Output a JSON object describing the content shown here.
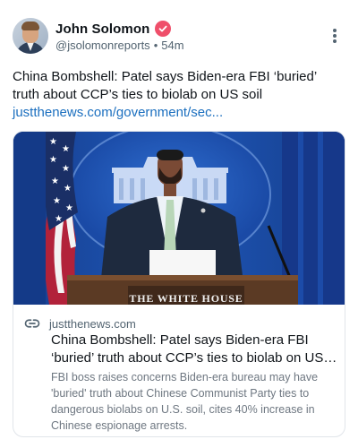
{
  "post": {
    "author": {
      "name": "John Solomon",
      "handle": "@jsolomonreports",
      "separator": "•",
      "timestamp": "54m",
      "verified_color": "#ef4f6a"
    },
    "text_line1": "China Bombshell: Patel says Biden-era FBI ‘buried’ truth about CCP’s ties to biolab on US soil",
    "link_text": "justthenews.com/government/sec...",
    "more_icon": "vertical-ellipsis-icon"
  },
  "card": {
    "image": {
      "sign_text": "THE WHITE HOUSE",
      "description_icons": [
        "american-flag",
        "speaker-at-podium"
      ]
    },
    "domain": "justthenews.com",
    "link_icon": "link-icon",
    "title_line1": "China Bombshell: Patel says Biden-era FBI",
    "title_line2": "‘buried’ truth about CCP’s ties to biolab on US s...",
    "description": "FBI boss raises concerns Biden-era bureau may have 'buried' truth about Chinese Communist Party ties to dangerous biolabs on U.S. soil, cites 40% increase in Chinese espionage arrests."
  },
  "colors": {
    "link": "#1b6fbf",
    "muted": "#536471",
    "text": "#0f1419"
  }
}
